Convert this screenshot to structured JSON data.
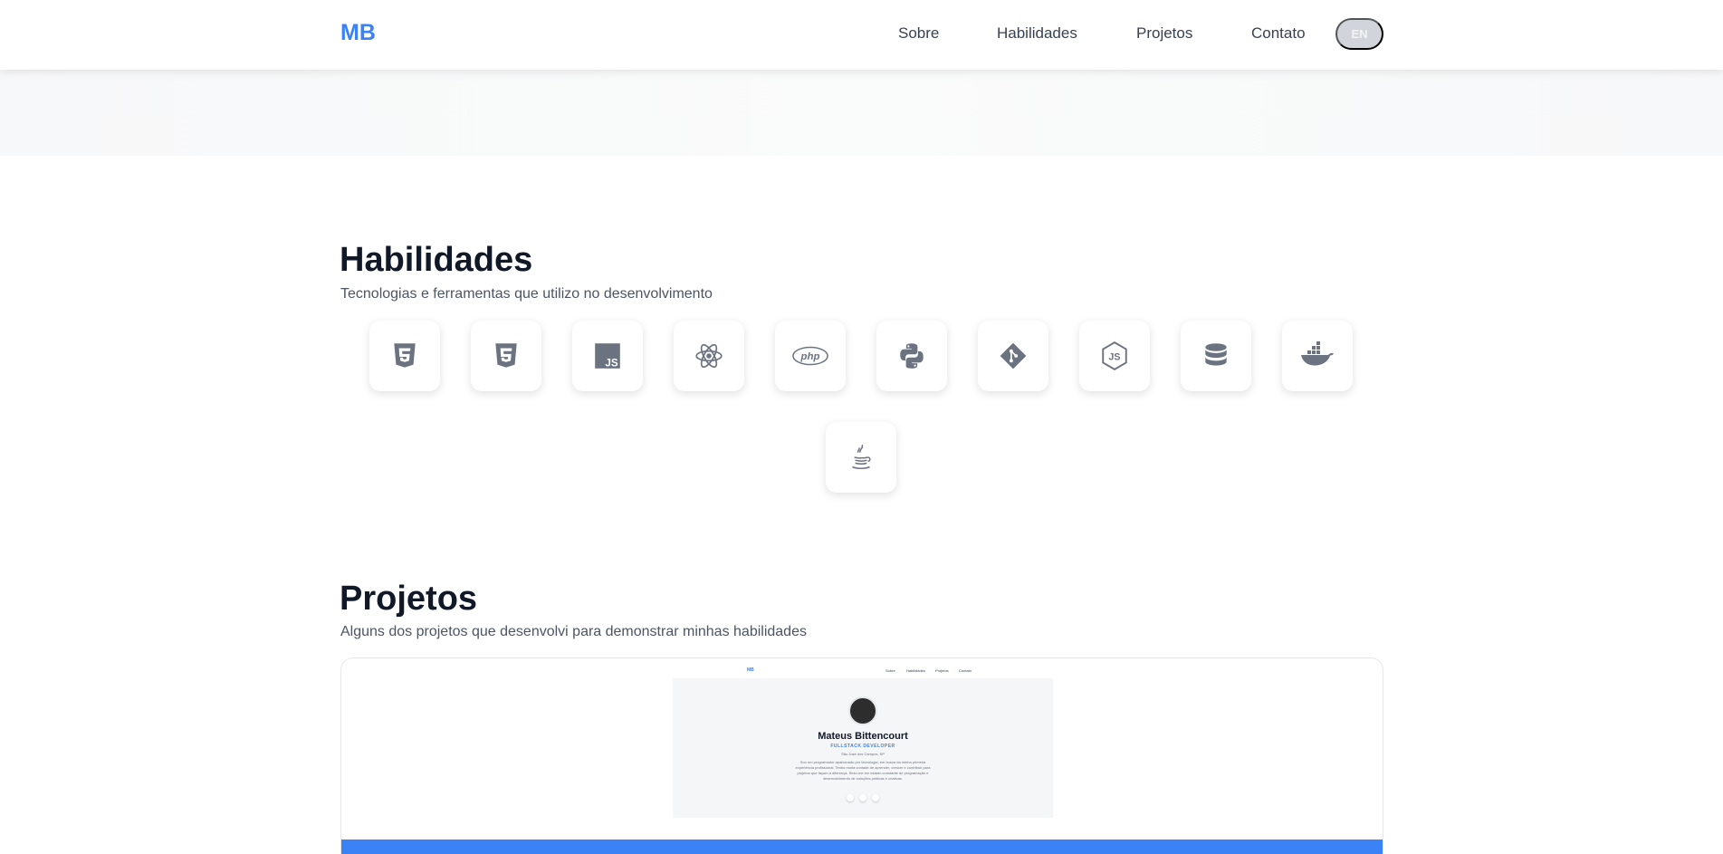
{
  "nav": {
    "logo": "MB",
    "links": [
      "Sobre",
      "Habilidades",
      "Projetos",
      "Contato"
    ],
    "lang_button": "EN"
  },
  "skills": {
    "title": "Habilidades",
    "subtitle": "Tecnologias e ferramentas que utilizo no desenvolvimento",
    "icons": [
      "html5-icon",
      "css3-icon",
      "javascript-icon",
      "react-icon",
      "php-icon",
      "python-icon",
      "git-icon",
      "nodejs-icon",
      "database-icon",
      "docker-icon",
      "java-icon"
    ]
  },
  "projects": {
    "title": "Projetos",
    "subtitle": "Alguns dos projetos que desenvolvi para demonstrar minhas habilidades",
    "preview": {
      "logo": "MB",
      "links": [
        "Sobre",
        "Habilidades",
        "Projetos",
        "Contato"
      ],
      "name": "Mateus Bittencourt",
      "role": "FULLSTACK DEVELOPER",
      "location": "São José dos Campos, SP",
      "bio": "Sou um programador apaixonado por tecnologia, em busca da minha primeira experiência profissional. Tenho muita vontade de aprender, crescer e contribuir para projetos que façam a diferença. Sinto-me em estado constante de programação e desenvolvimento de soluções práticas e criativas."
    }
  },
  "colors": {
    "accent": "#3b82f6",
    "icon": "#6b7280"
  }
}
